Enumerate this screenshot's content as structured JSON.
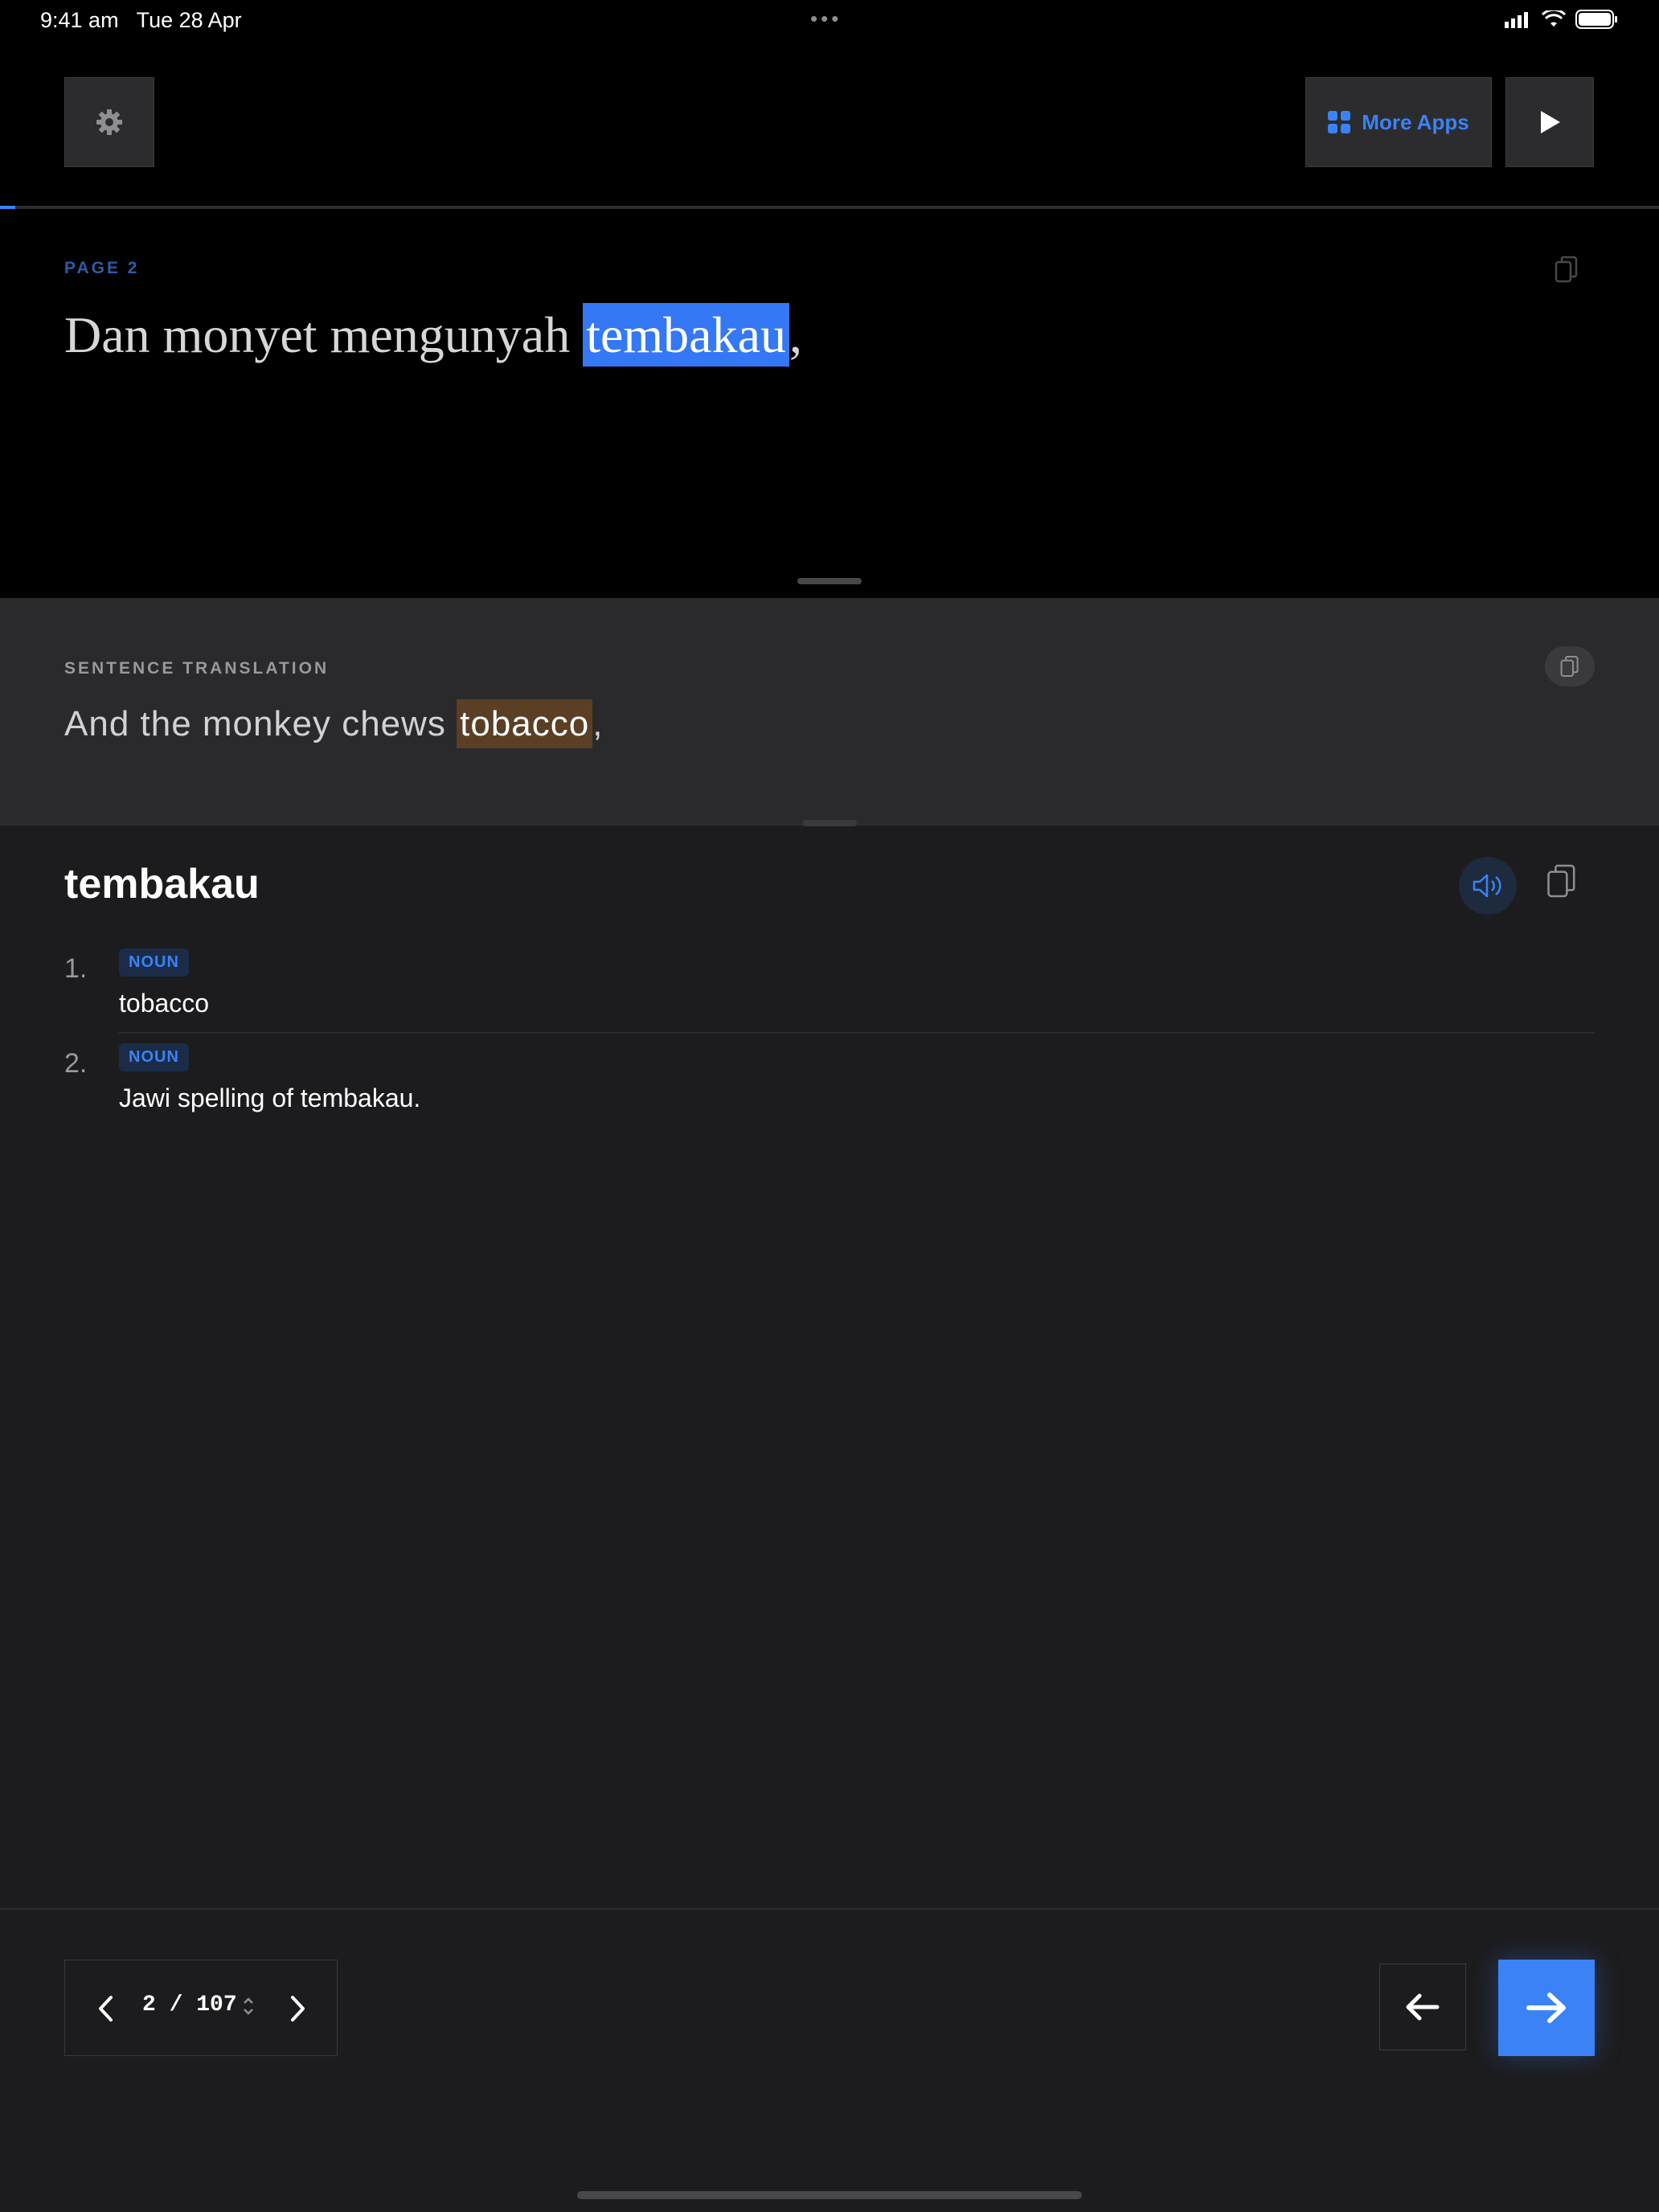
{
  "status_bar": {
    "time": "9:41 am",
    "date": "Tue 28 Apr",
    "dots": "•••"
  },
  "toolbar": {
    "more_apps_label": "More Apps"
  },
  "reader": {
    "page_label": "PAGE  2",
    "sentence_before": "Dan monyet mengunyah ",
    "sentence_highlight": "tembakau",
    "sentence_after": ",",
    "progress_fraction": 0.009
  },
  "translation": {
    "label": "SENTENCE TRANSLATION",
    "text_before": "And the monkey chews ",
    "text_highlight": "tobacco",
    "text_after": ","
  },
  "definition": {
    "word": "tembakau",
    "entries": [
      {
        "num": "1.",
        "pos": "NOUN",
        "text": "tobacco"
      },
      {
        "num": "2.",
        "pos": "NOUN",
        "text": "Jawi spelling of tembakau."
      }
    ]
  },
  "pager": {
    "current": "2",
    "separator": "/",
    "total": "107"
  },
  "colors": {
    "accent": "#3b82f6",
    "highlight_source": "#3478f6",
    "highlight_translation": "#5a3f25"
  },
  "icons": [
    "gear-icon",
    "grid-icon",
    "play-icon",
    "copy-icon",
    "speaker-icon",
    "chevron-left-icon",
    "chevron-right-icon",
    "updown-icon",
    "arrow-left-icon",
    "arrow-right-icon"
  ]
}
